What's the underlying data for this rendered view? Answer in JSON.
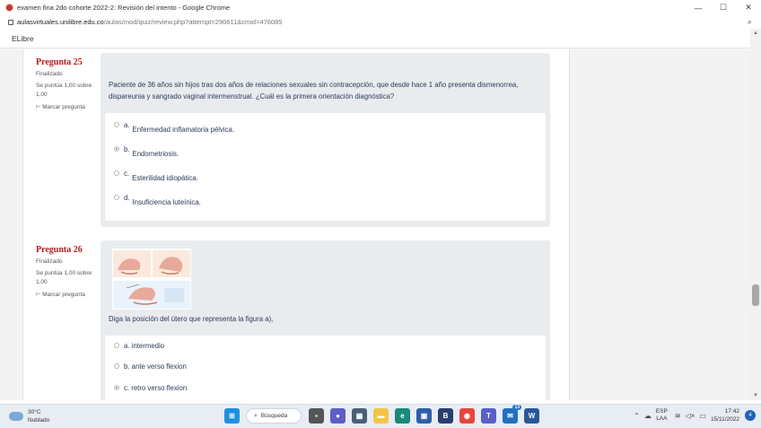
{
  "browser": {
    "window_title": "examen fina 2do cohorte 2022-2: Revisión del intento - Google Chrome",
    "url_host": "aulasvirtuales.unilibre.edu.co",
    "url_path": "/aulas/mod/quiz/review.php?attempt=290611&cmid=476085"
  },
  "site": {
    "name": "ELibre"
  },
  "questions": [
    {
      "number_label": "Pregunta",
      "number": "25",
      "state": "Finalizado",
      "grade_line1": "Se puntúa 1,00 sobre",
      "grade_line2": "1,00",
      "flag_label": "Marcar pregunta",
      "text_line1": "Paciente de 36 años sin hijos tras dos años de relaciones sexuales sin contracepción, que desde hace 1 año presenta dismenorrea,",
      "text_line2": "dispareunia y sangrado vaginal intermenstrual. ¿Cuál es la primera orientación diagnóstica?",
      "options": [
        {
          "letter": "a.",
          "text": "Enfermedad inflamatoria pélvica.",
          "checked": false
        },
        {
          "letter": "b.",
          "text": "Endometriosis.",
          "checked": true
        },
        {
          "letter": "c.",
          "text": "Esterilidad idiopática.",
          "checked": false
        },
        {
          "letter": "d.",
          "text": "Insuficiencia luteínica.",
          "checked": false
        }
      ]
    },
    {
      "number_label": "Pregunta",
      "number": "26",
      "state": "Finalizado",
      "grade_line1": "Se puntúa 1,00 sobre",
      "grade_line2": "1,00",
      "flag_label": "Marcar pregunta",
      "text_line1": "Diga la posición del útero que representa la figura  a),",
      "options": [
        {
          "text": "a. intermedio",
          "checked": false
        },
        {
          "text": "b. ante verso flexion",
          "checked": false
        },
        {
          "text": "c. retro verso flexion",
          "checked": true
        }
      ]
    }
  ],
  "taskbar": {
    "temperature": "30°C",
    "weather": "Nublado",
    "search_label": "Búsqueda",
    "mail_badge": "13",
    "lang_line1": "ESP",
    "lang_line2": "LAA",
    "time": "17:42",
    "date": "15/11/2022",
    "notification_count": "4"
  },
  "colors": {
    "question_number": "#b71c1c",
    "question_box": "#e9ecef",
    "question_text": "#2b3a55"
  }
}
